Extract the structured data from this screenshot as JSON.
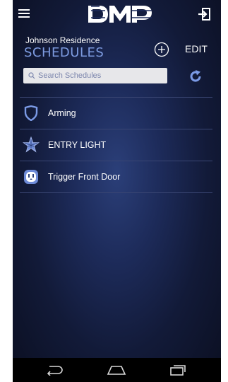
{
  "app": {
    "logo_text": "DMP"
  },
  "header": {
    "residence": "Johnson Residence",
    "title": "SCHEDULES",
    "edit_label": "EDIT"
  },
  "search": {
    "placeholder": "Search Schedules"
  },
  "schedules": [
    {
      "label": "Arming",
      "icon": "shield-icon"
    },
    {
      "label": "ENTRY LIGHT",
      "icon": "star-light-icon"
    },
    {
      "label": "Trigger Front Door",
      "icon": "outlet-icon"
    }
  ],
  "icons": {
    "menu": "hamburger-menu-icon",
    "logout": "logout-icon",
    "add": "add-circle-icon",
    "refresh": "refresh-icon",
    "search": "search-icon",
    "back": "back-icon",
    "home": "home-icon",
    "recents": "recents-icon"
  },
  "colors": {
    "title": "#7d9be0",
    "accent": "#7b9ae6",
    "background": "#1d2b5a",
    "divider": "#3a4673"
  }
}
